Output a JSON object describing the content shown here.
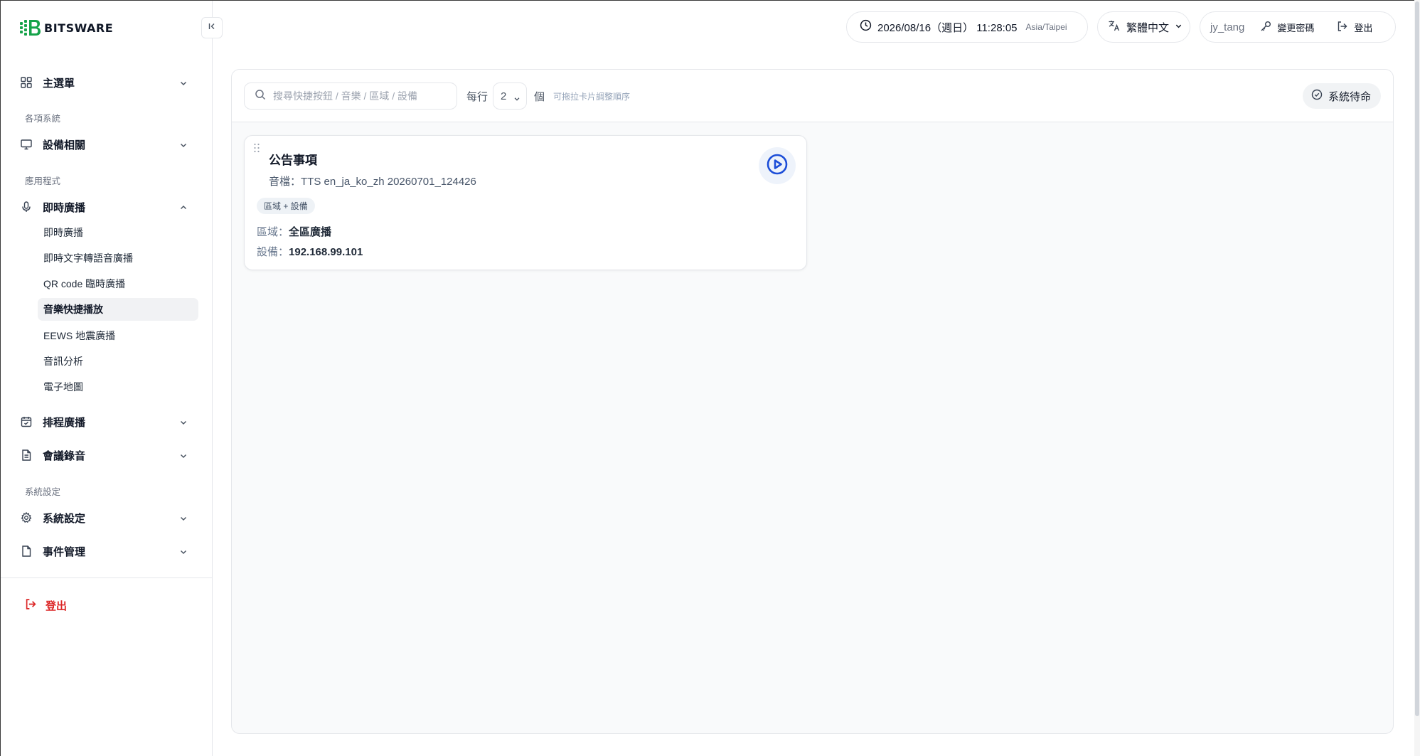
{
  "brand": {
    "name": "BITSWARE",
    "accent": "#16a34a"
  },
  "header": {
    "datetime": "2026/08/16（週日） 11:28:05",
    "timezone": "Asia/Taipei",
    "language": "繁體中文",
    "username": "jy_tang",
    "change_password": "變更密碼",
    "logout": "登出"
  },
  "sidebar": {
    "main_menu": "主選單",
    "section_systems": "各項系統",
    "devices": "設備相關",
    "section_apps": "應用程式",
    "live_broadcast": "即時廣播",
    "sub_items": [
      "即時廣播",
      "即時文字轉語音廣播",
      "QR code 臨時廣播",
      "音樂快捷播放",
      "EEWS 地震廣播",
      "音訊分析",
      "電子地圖"
    ],
    "active_sub_item": "音樂快捷播放",
    "scheduled": "排程廣播",
    "meeting_record": "會議錄音",
    "section_settings": "系統設定",
    "settings": "系統設定",
    "events": "事件管理",
    "logout": "登出",
    "logout_color": "#dc2626"
  },
  "toolbar": {
    "search_placeholder": "搜尋快捷按鈕 / 音樂 / 區域 / 設備",
    "per_row_label": "每行",
    "per_row_value": "2",
    "per_row_unit": "個",
    "drag_hint": "可拖拉卡片調整順序",
    "status": "系統待命"
  },
  "cards": [
    {
      "title": "公告事項",
      "file": "音檔：TTS en_ja_ko_zh 20260701_124426",
      "badge": "區域 + 設備",
      "zone_label": "區域：",
      "zone_value": "全區廣播",
      "device_label": "設備：",
      "device_value": "192.168.99.101"
    }
  ],
  "icons": {
    "play_color": "#1d4ed8"
  }
}
